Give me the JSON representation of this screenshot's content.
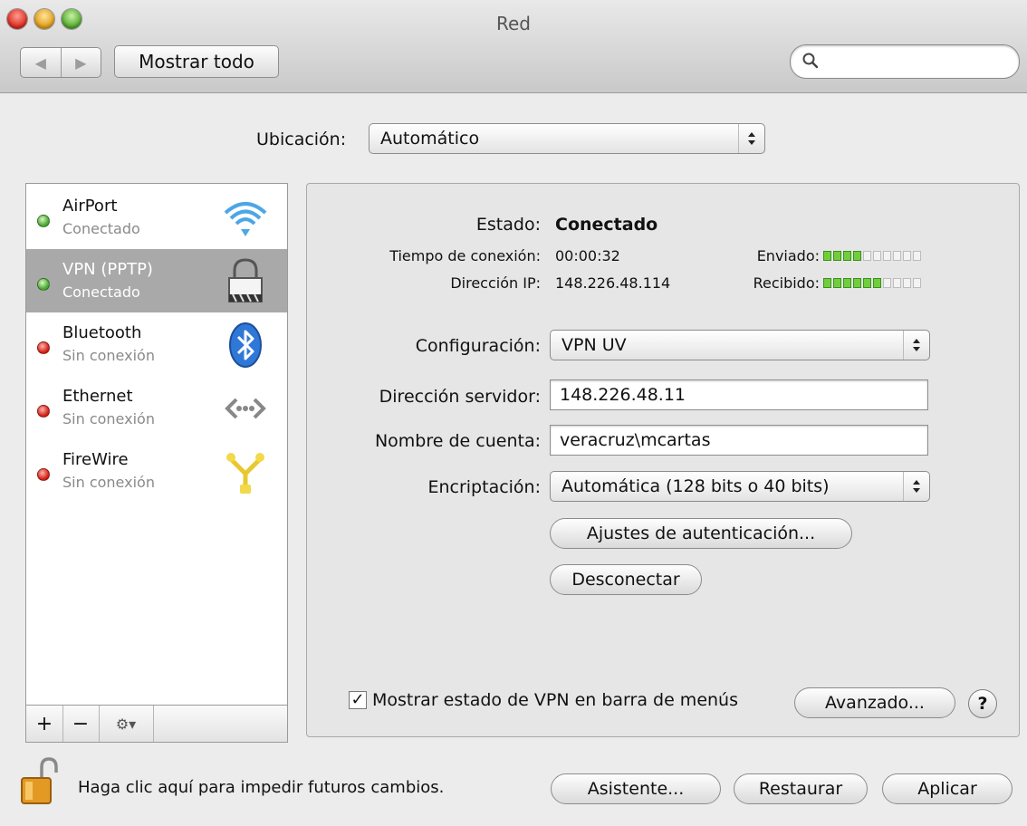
{
  "window": {
    "title": "Red"
  },
  "toolbar": {
    "back_arrow": "◀",
    "forward_arrow": "▶",
    "show_all_label": "Mostrar todo",
    "search_placeholder": ""
  },
  "location": {
    "label": "Ubicación:",
    "value": "Automático"
  },
  "sidebar": {
    "services": [
      {
        "name": "AirPort",
        "status": "Conectado",
        "state": "green",
        "icon": "wifi-icon"
      },
      {
        "name": "VPN (PPTP)",
        "status": "Conectado",
        "state": "green",
        "icon": "lock-icon",
        "selected": true
      },
      {
        "name": "Bluetooth",
        "status": "Sin conexión",
        "state": "red",
        "icon": "bluetooth-icon"
      },
      {
        "name": "Ethernet",
        "status": "Sin conexión",
        "state": "red",
        "icon": "ethernet-icon"
      },
      {
        "name": "FireWire",
        "status": "Sin conexión",
        "state": "red",
        "icon": "firewire-icon"
      }
    ],
    "toolbar": {
      "add": "+",
      "remove": "−",
      "gear": "⚙▾"
    }
  },
  "detail": {
    "status_label": "Estado:",
    "status_value": "Conectado",
    "time_label": "Tiempo de conexión:",
    "time_value": "00:00:32",
    "ip_label": "Dirección IP:",
    "ip_value": "148.226.48.114",
    "sent_label": "Enviado:",
    "sent_level": 4,
    "received_label": "Recibido:",
    "received_level": 6,
    "meter_segments": 10,
    "config_label": "Configuración:",
    "config_value": "VPN UV",
    "server_label": "Dirección servidor:",
    "server_value": "148.226.48.11",
    "account_label": "Nombre de cuenta:",
    "account_value": "veracruz\\mcartas",
    "encryption_label": "Encriptación:",
    "encryption_value": "Automática (128 bits o 40 bits)",
    "auth_button": "Ajustes de autenticación...",
    "disconnect_button": "Desconectar",
    "show_vpn_status_label": "Mostrar estado de VPN en barra de menús",
    "show_vpn_status_checked": true,
    "advanced_button": "Avanzado...",
    "help": "?"
  },
  "footer": {
    "lock_text": "Haga clic aquí para impedir futuros cambios.",
    "assistant_button": "Asistente...",
    "revert_button": "Restaurar",
    "apply_button": "Aplicar"
  },
  "colors": {
    "meter_on": "#6fcf3a",
    "selected_row": "#a9a9a9",
    "status_green": "#46a631",
    "status_red": "#d21f14"
  }
}
